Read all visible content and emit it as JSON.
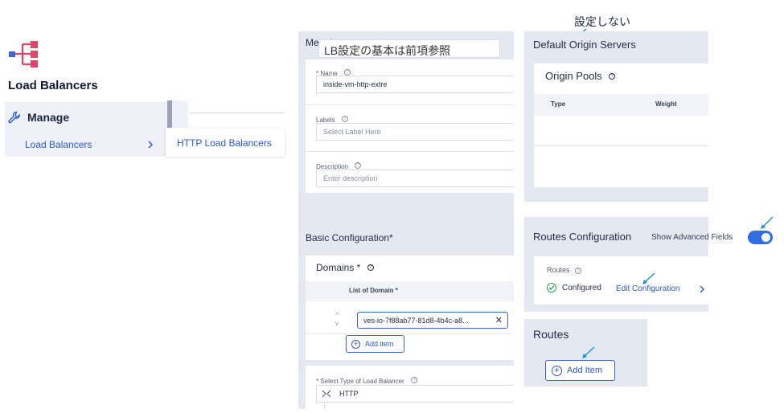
{
  "nav": {
    "title": "Load Balancers",
    "manage_label": "Manage",
    "active_item": "Load Balancers",
    "submenu_item": "HTTP Load Balancers"
  },
  "form": {
    "metadata_title": "Metadata",
    "annotation_text": "LB設定の基本は前項参照",
    "name_label": "* Name",
    "name_value": "inside-vm-http-extre",
    "labels_label": "Labels",
    "labels_placeholder": "Select Label Here",
    "description_label": "Description",
    "description_placeholder": "Enter description",
    "basic_config_title": "Basic Configuration*",
    "domains_title": "Domains *",
    "list_of_domain_header": "List of Domain *",
    "domain_value": "ves-io-7f88ab77-81d8-4b4c-a8...",
    "add_item_label": "Add item",
    "lb_type_label": "* Select Type of Load Balancer",
    "lb_type_value": "HTTP"
  },
  "right": {
    "annotation_top": "設定しない",
    "default_origin_title": "Default Origin Servers",
    "origin_pools_title": "Origin Pools",
    "col_type": "Type",
    "col_weight": "Weight",
    "routes_config_title": "Routes Configuration",
    "show_advanced_label": "Show Advanced Fields",
    "routes_label": "Routes",
    "configured_label": "Configured",
    "edit_config_label": "Edit Configuration",
    "routes_title": "Routes",
    "add_item_label": "Add Item"
  },
  "colors": {
    "accent": "#2c59d6",
    "arrow": "#1f8fd6",
    "success": "#22a35a",
    "panel_bg": "#e4e8f1"
  },
  "icons": [
    "load-balancer-logo-icon",
    "wrench-icon",
    "chevron-right-icon",
    "help-icon",
    "close-icon",
    "plus-circle-icon",
    "check-circle-icon",
    "http-route-icon",
    "sort-arrows-icon"
  ]
}
